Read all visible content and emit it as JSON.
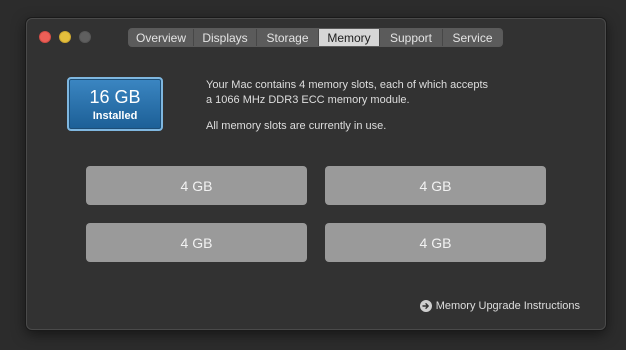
{
  "window": {
    "controls": [
      "close",
      "minimize",
      "zoom"
    ]
  },
  "tabs": [
    {
      "label": "Overview",
      "active": false
    },
    {
      "label": "Displays",
      "active": false
    },
    {
      "label": "Storage",
      "active": false
    },
    {
      "label": "Memory",
      "active": true
    },
    {
      "label": "Support",
      "active": false
    },
    {
      "label": "Service",
      "active": false
    }
  ],
  "memory": {
    "total": "16 GB",
    "status": "Installed",
    "description_line1": "Your Mac contains 4 memory slots, each of which accepts",
    "description_line2": "a 1066 MHz DDR3 ECC memory module.",
    "slots_note": "All memory slots are currently in use.",
    "slots": [
      "4 GB",
      "4 GB",
      "4 GB",
      "4 GB"
    ]
  },
  "links": {
    "upgrade_instructions": "Memory Upgrade Instructions",
    "upgrade_icon": "arrow-circle-right-icon"
  },
  "colors": {
    "accent": "#2f7bbf",
    "slot": "#9a9a9a",
    "window_bg": "#323232"
  }
}
